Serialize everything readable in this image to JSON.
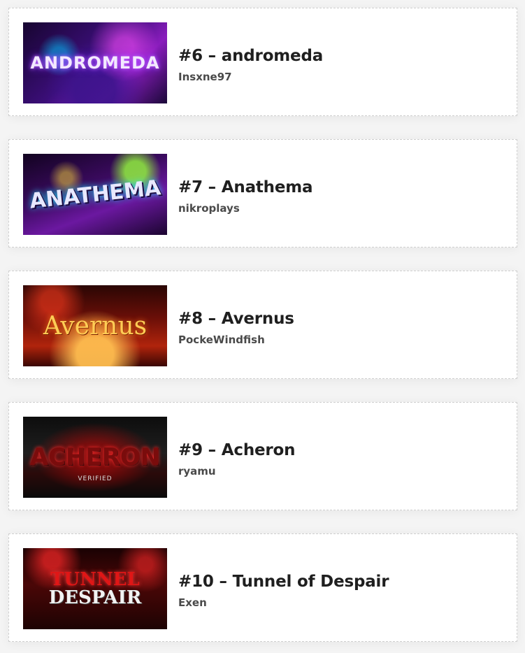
{
  "entries": [
    {
      "title": "#6 – andromeda",
      "author": "Insxne97",
      "thumb_text": "ANDROMEDA"
    },
    {
      "title": "#7 – Anathema",
      "author": "nikroplays",
      "thumb_text": "ANATHEMA"
    },
    {
      "title": "#8 – Avernus",
      "author": "PockeWindfish",
      "thumb_text": "Avernus"
    },
    {
      "title": "#9 – Acheron",
      "author": "ryamu",
      "thumb_text": "ACHERON",
      "thumb_sub": "VERIFIED"
    },
    {
      "title": "#10 – Tunnel of Despair",
      "author": "Exen",
      "thumb_text_1": "TUNNEL",
      "thumb_text_2": "DESPAIR"
    }
  ]
}
